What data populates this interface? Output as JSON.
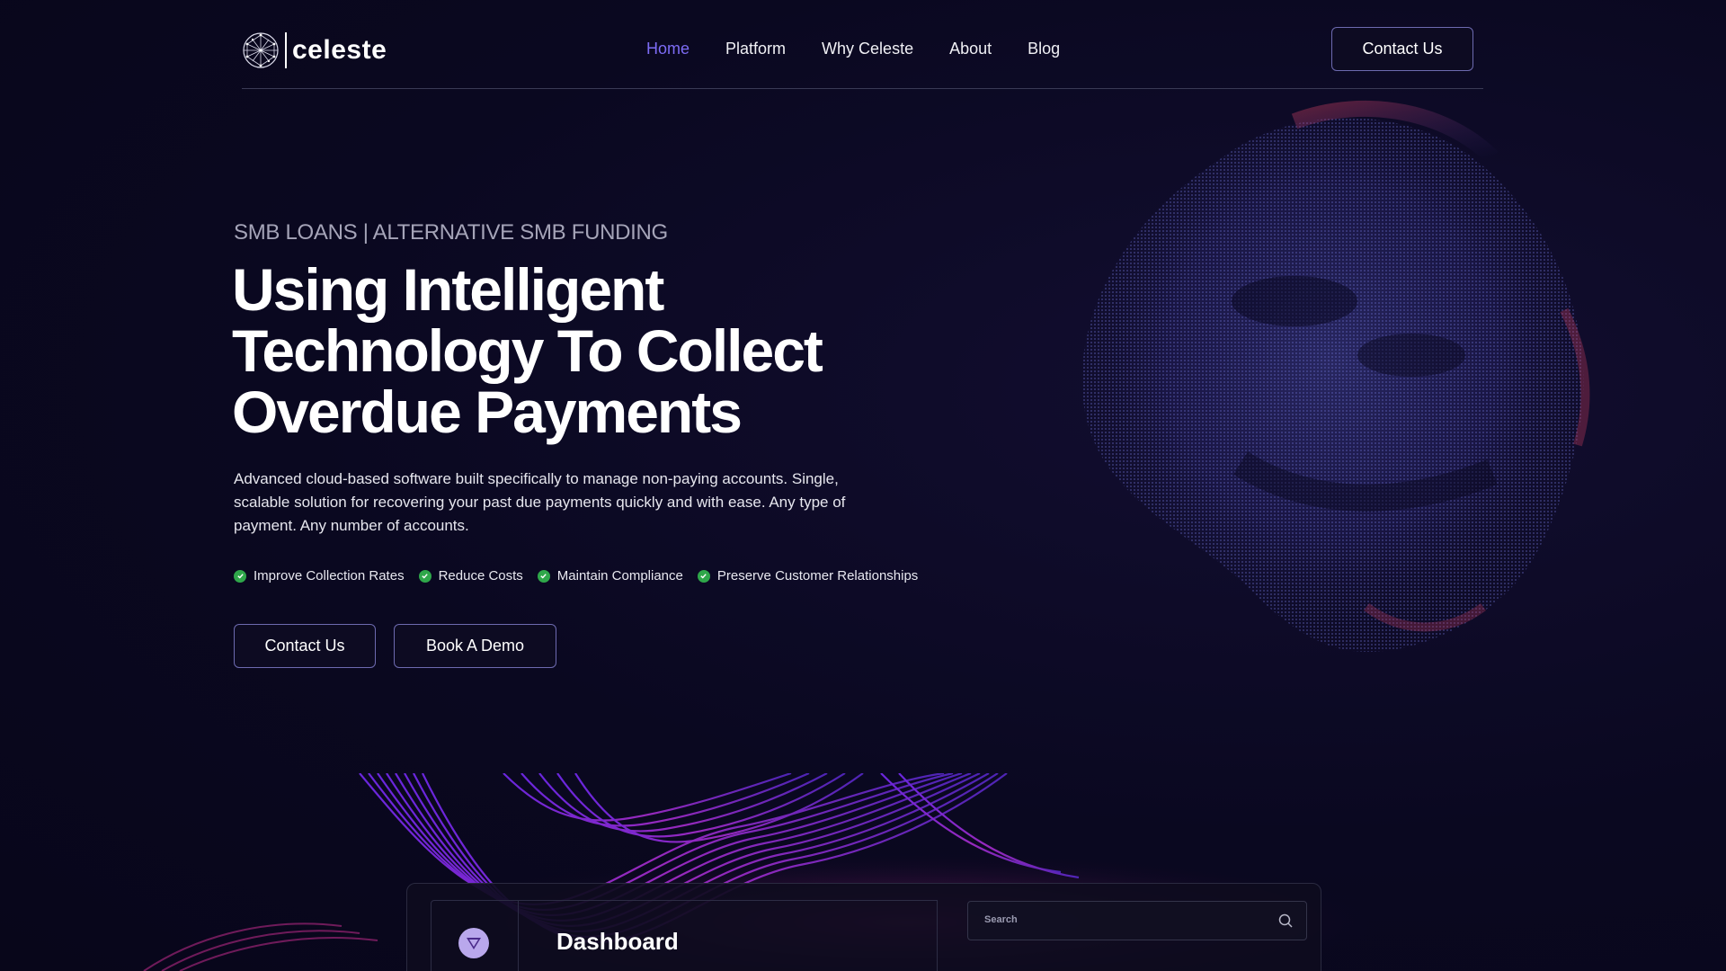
{
  "brand": {
    "name": "celeste"
  },
  "nav": {
    "items": [
      {
        "label": "Home",
        "active": true
      },
      {
        "label": "Platform",
        "active": false
      },
      {
        "label": "Why Celeste",
        "active": false
      },
      {
        "label": "About",
        "active": false
      },
      {
        "label": "Blog",
        "active": false
      }
    ],
    "cta_label": "Contact Us"
  },
  "hero": {
    "eyebrow": "SMB LOANS | ALTERNATIVE SMB FUNDING",
    "headline_lines": [
      "Using Intelligent",
      "Technology To Collect",
      "Overdue Payments"
    ],
    "lead": "Advanced cloud-based software built specifically to manage non-paying accounts. Single, scalable solution for recovering your past due payments quickly and with ease. Any type of payment. Any number of accounts.",
    "bullets": [
      "Improve Collection Rates",
      "Reduce Costs",
      "Maintain Compliance",
      "Preserve Customer Relationships"
    ],
    "primary_button": "Contact Us",
    "secondary_button": "Book A Demo"
  },
  "dashboard": {
    "title": "Dashboard",
    "search_placeholder": "Search"
  },
  "icons": {
    "logo": "globe-network-icon",
    "check": "check-circle-icon",
    "dashboard_logo": "triangle-badge-icon",
    "search": "search-icon"
  },
  "colors": {
    "background": "#0a0820",
    "accent": "#7d6cf5",
    "check": "#2fa74a",
    "button_border": "#6d6ab0"
  }
}
